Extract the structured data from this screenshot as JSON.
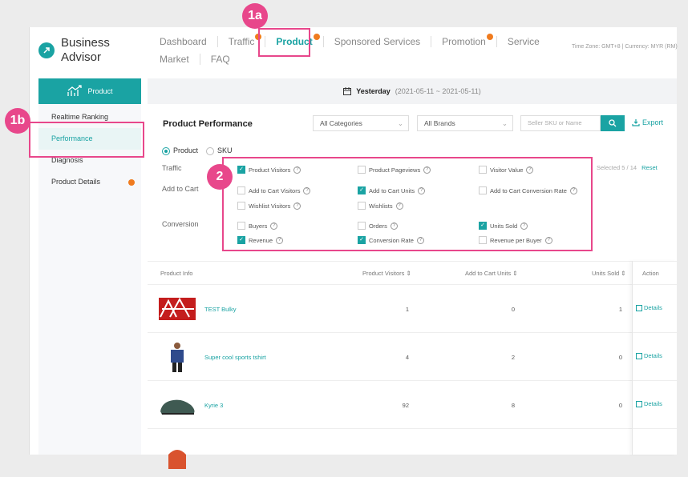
{
  "brand": {
    "line1": "Business",
    "line2": "Advisor"
  },
  "nav": {
    "row1": [
      {
        "label": "Dashboard",
        "dot": false,
        "active": false
      },
      {
        "label": "Traffic",
        "dot": true,
        "active": false
      },
      {
        "label": "Product",
        "dot": true,
        "active": true
      },
      {
        "label": "Sponsored Services",
        "dot": false,
        "active": false
      },
      {
        "label": "Promotion",
        "dot": true,
        "active": false
      },
      {
        "label": "Service",
        "dot": false,
        "active": false
      }
    ],
    "row2": [
      {
        "label": "Market"
      },
      {
        "label": "FAQ"
      }
    ],
    "timezone": "Time Zone: GMT+8 | Currency: MYR (RM)"
  },
  "sidebar": {
    "header": "Product",
    "items": [
      {
        "label": "Realtime Ranking",
        "active": false,
        "dot": false
      },
      {
        "label": "Performance",
        "active": true,
        "dot": false
      },
      {
        "label": "Diagnosis",
        "active": false,
        "dot": false
      },
      {
        "label": "Product Details",
        "active": false,
        "dot": true
      }
    ]
  },
  "datebar": {
    "label": "Yesterday",
    "range": "(2021-05-11 ~ 2021-05-11)"
  },
  "performance": {
    "title": "Product Performance",
    "category_select": "All Categories",
    "brand_select": "All Brands",
    "search_placeholder": "Seller SKU or Name",
    "export_label": "Export",
    "radio_product": "Product",
    "radio_sku": "SKU",
    "group_traffic": "Traffic",
    "group_cart": "Add to Cart",
    "group_conversion": "Conversion",
    "selected_label": "Selected",
    "selected_value": "5 / 14",
    "reset_label": "Reset",
    "metrics": {
      "product_visitors": "Product Visitors",
      "product_pageviews": "Product Pageviews",
      "visitor_value": "Visitor Value",
      "add_to_cart_visitors": "Add to Cart Visitors",
      "add_to_cart_units": "Add to Cart Units",
      "add_to_cart_conversion_rate": "Add to Cart Conversion Rate",
      "wishlist_visitors": "Wishlist Visitors",
      "wishlists": "Wishlists",
      "buyers": "Buyers",
      "orders": "Orders",
      "units_sold": "Units Sold",
      "revenue": "Revenue",
      "conversion_rate": "Conversion Rate",
      "revenue_per_buyer": "Revenue per Buyer"
    }
  },
  "table": {
    "headers": {
      "product_info": "Product Info",
      "product_visitors": "Product Visitors",
      "add_to_cart_units": "Add to Cart Units",
      "units_sold": "Units Sold",
      "action": "Action"
    },
    "rows": [
      {
        "name": "TEST Bulky",
        "visitors": "1",
        "cart_units": "0",
        "units_sold": "1",
        "action": "Details"
      },
      {
        "name": "Super cool sports tshirt",
        "visitors": "4",
        "cart_units": "2",
        "units_sold": "0",
        "action": "Details"
      },
      {
        "name": "Kyrie 3",
        "visitors": "92",
        "cart_units": "8",
        "units_sold": "0",
        "action": "Details"
      }
    ]
  },
  "callouts": {
    "c1a": "1a",
    "c1b": "1b",
    "c2": "2"
  },
  "colors": {
    "accent": "#1aa3a3",
    "highlight": "#e8478b",
    "dot": "#f07b1e"
  }
}
